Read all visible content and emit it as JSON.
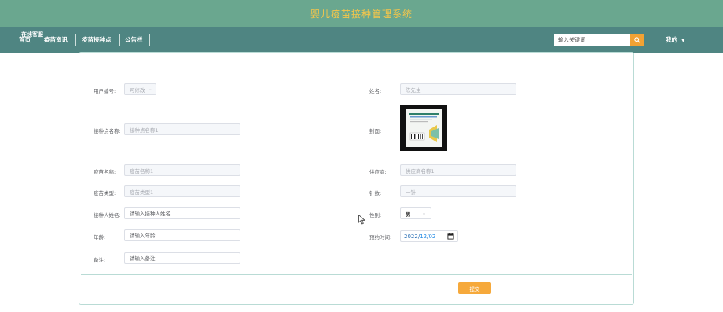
{
  "header": {
    "title": "婴儿疫苗接种管理系统"
  },
  "nav": {
    "items": [
      {
        "label": "首页"
      },
      {
        "label": "疫苗资讯"
      },
      {
        "label": "疫苗接种点"
      },
      {
        "label": "公告栏"
      }
    ],
    "overlap_label": "在线客服",
    "search": {
      "placeholder": "输入关键词"
    },
    "user_menu": "我的"
  },
  "form": {
    "user_no": {
      "label": "用户编号:",
      "value": "可修改"
    },
    "name": {
      "label": "姓名:",
      "value": "陈先生"
    },
    "site_name": {
      "label": "接种点名称:",
      "value": "接种点名称1"
    },
    "cover": {
      "label": "封面:"
    },
    "vaccine_name": {
      "label": "疫苗名称:",
      "value": "疫苗名称1"
    },
    "supplier": {
      "label": "供应商:",
      "value": "供应商名称1"
    },
    "vaccine_type": {
      "label": "疫苗类型:",
      "value": "疫苗类型1"
    },
    "doses": {
      "label": "针数:",
      "value": "一针"
    },
    "recipient": {
      "label": "接种人姓名:",
      "placeholder": "请输入接种人姓名"
    },
    "gender": {
      "label": "性别:",
      "value": "男"
    },
    "age": {
      "label": "年龄:",
      "placeholder": "请输入年龄"
    },
    "appointment": {
      "label": "预约时间:",
      "year": "2022",
      "month": "12",
      "day": "02"
    },
    "remark": {
      "label": "备注:",
      "placeholder": "请输入备注"
    },
    "submit_label": "提交"
  },
  "colors": {
    "title_bar": "#6aa78f",
    "nav_bar": "#4f8582",
    "title_text": "#f6c64a",
    "accent": "#f6a93b",
    "card_border": "#b9dbd5"
  }
}
